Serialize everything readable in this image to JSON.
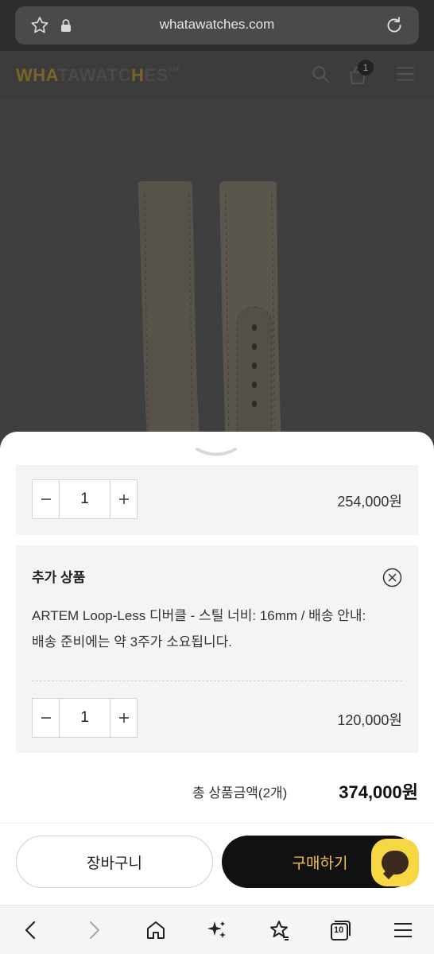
{
  "browser": {
    "url": "whatawatches.com",
    "tab_count": "10"
  },
  "site": {
    "logo_prefix": "W",
    "logo_h": "H",
    "logo_a": "A",
    "logo_mid": "TAWATC",
    "logo_h2": "H",
    "logo_end": "ES",
    "logo_tm": "TM",
    "cart_count": "1"
  },
  "order": {
    "item1": {
      "quantity": "1",
      "price": "254,000원"
    },
    "addon": {
      "title": "추가 상품",
      "description": "ARTEM Loop-Less 디버클 - 스틸 너비: 16mm / 배송 안내: 배송 준비에는 약 3주가 소요됩니다.",
      "quantity": "1",
      "price": "120,000원"
    },
    "total_label": "총 상품금액(2개)",
    "total_value": "374,000원"
  },
  "actions": {
    "cart_label": "장바구니",
    "buy_label": "구매하기"
  },
  "colors": {
    "accent": "#f3c44a",
    "chat": "#f7d842",
    "logo_gold": "#7a6527"
  }
}
